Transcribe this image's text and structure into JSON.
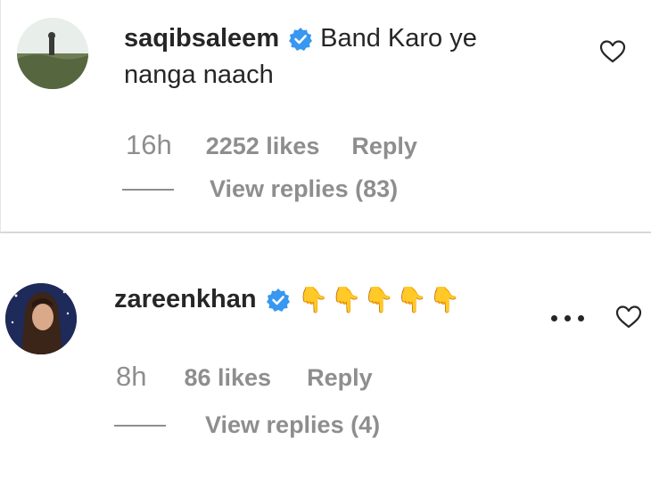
{
  "comments": [
    {
      "username": "saqibsaleem",
      "text_line1": "Band Karo ye",
      "text_line2": "nanga naach",
      "time": "16h",
      "likes": "2252 likes",
      "reply_label": "Reply",
      "view_replies": "View replies (83)",
      "icons": [
        "avatar",
        "verified-badge-icon",
        "heart-icon"
      ]
    },
    {
      "username": "zareenkhan",
      "emoji": "👇👇👇👇👇",
      "time": "8h",
      "likes": "86 likes",
      "reply_label": "Reply",
      "view_replies": "View replies (4)",
      "icons": [
        "avatar",
        "verified-badge-icon",
        "more-options-icon",
        "heart-icon"
      ]
    }
  ],
  "colors": {
    "text": "#262626",
    "secondary": "#8e8e8e",
    "verified": "#3897f0"
  }
}
